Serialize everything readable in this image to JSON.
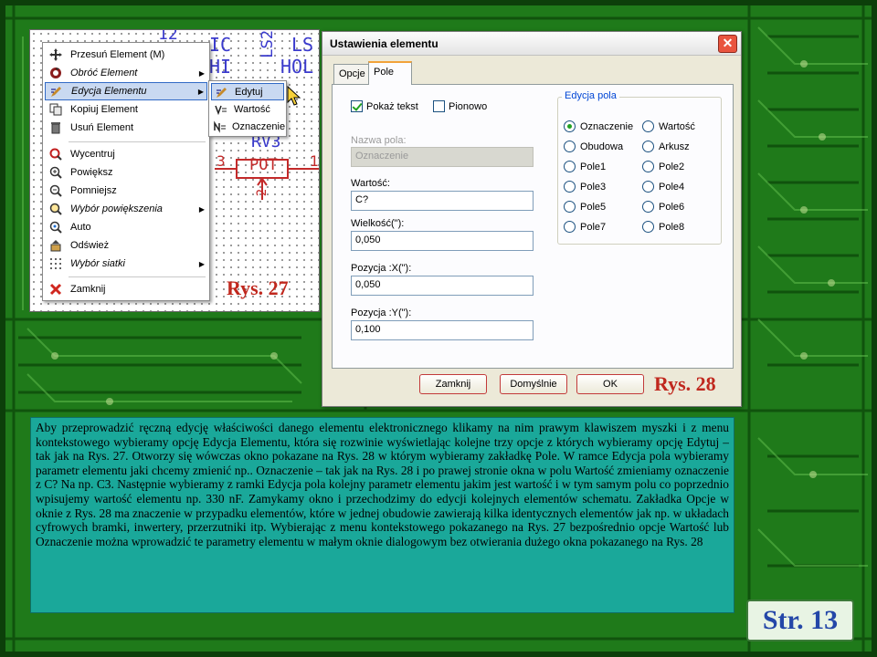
{
  "colors": {
    "pcb_green": "#1f7a1a",
    "label_red": "#c0281e",
    "text_box_teal": "#1aa89a",
    "page_number_blue": "#2447a8",
    "menu_highlight": "#c9d9f1"
  },
  "schematic": {
    "labels": {
      "top_ref": "12",
      "col1_a": "IC",
      "col1_b": "HI",
      "col2": "LS2",
      "col3_a": "LS",
      "col3_b": "HOL",
      "ref_rv": "RV3",
      "pin_left": "3",
      "pin_right": "1",
      "pin_bottom": "2",
      "part": "POT"
    }
  },
  "context_menu": {
    "items": [
      {
        "label": "Przesuń Element (M)",
        "icon": "move-icon",
        "submenu": false,
        "italic": false
      },
      {
        "label": "Obróć Element",
        "icon": "rotate-icon",
        "submenu": true,
        "italic": true
      },
      {
        "label": "Edycja Elementu",
        "icon": "edit-element-icon",
        "submenu": true,
        "italic": true,
        "highlighted": true
      },
      {
        "label": "Kopiuj Element",
        "icon": "copy-icon",
        "submenu": false,
        "italic": false
      },
      {
        "label": "Usuń Element",
        "icon": "delete-icon",
        "submenu": false,
        "italic": false
      },
      {
        "label": "Wycentruj",
        "icon": "center-icon",
        "submenu": false,
        "italic": false
      },
      {
        "label": "Powiększ",
        "icon": "zoom-in-icon",
        "submenu": false,
        "italic": false
      },
      {
        "label": "Pomniejsz",
        "icon": "zoom-out-icon",
        "submenu": false,
        "italic": false
      },
      {
        "label": "Wybór powiększenia",
        "icon": "zoom-select-icon",
        "submenu": true,
        "italic": true
      },
      {
        "label": "Auto",
        "icon": "auto-zoom-icon",
        "submenu": false,
        "italic": false
      },
      {
        "label": "Odśwież",
        "icon": "refresh-icon",
        "submenu": false,
        "italic": false
      },
      {
        "label": "Wybór siatki",
        "icon": "grid-icon",
        "submenu": true,
        "italic": true
      },
      {
        "label": "Zamknij",
        "icon": "close-x-icon",
        "submenu": false,
        "italic": false
      }
    ],
    "submenu": [
      {
        "label": "Edytuj",
        "icon": "edit-icon",
        "highlighted": true
      },
      {
        "label": "Wartość",
        "icon": "value-icon"
      },
      {
        "label": "Oznaczenie",
        "icon": "reference-icon"
      }
    ]
  },
  "rys27_label": "Rys. 27",
  "rys28_label": "Rys. 28",
  "dialog": {
    "title": "Ustawienia elementu",
    "close_glyph": "✕",
    "tabs": [
      "Opcje",
      "Pole"
    ],
    "checkboxes": [
      {
        "label": "Pokaż tekst",
        "checked": true
      },
      {
        "label": "Pionowo",
        "checked": false
      }
    ],
    "fields": [
      {
        "label": "Nazwa pola:",
        "value": "Oznaczenie",
        "disabled": true
      },
      {
        "label": "Wartość:",
        "value": "C?",
        "disabled": false
      },
      {
        "label": "Wielkość(\"):",
        "value": "0,050",
        "disabled": false
      },
      {
        "label": "Pozycja :X(\"):",
        "value": "0,050",
        "disabled": false
      },
      {
        "label": "Pozycja :Y(\"):",
        "value": "0,100",
        "disabled": false
      }
    ],
    "group_title": "Edycja pola",
    "radios_left": [
      {
        "label": "Oznaczenie",
        "checked": true
      },
      {
        "label": "Obudowa",
        "checked": false
      },
      {
        "label": "Pole1",
        "checked": false
      },
      {
        "label": "Pole3",
        "checked": false
      },
      {
        "label": "Pole5",
        "checked": false
      },
      {
        "label": "Pole7",
        "checked": false
      }
    ],
    "radios_right": [
      {
        "label": "Wartość",
        "checked": false
      },
      {
        "label": "Arkusz",
        "checked": false
      },
      {
        "label": "Pole2",
        "checked": false
      },
      {
        "label": "Pole4",
        "checked": false
      },
      {
        "label": "Pole6",
        "checked": false
      },
      {
        "label": "Pole8",
        "checked": false
      }
    ],
    "buttons": {
      "close": "Zamknij",
      "default": "Domyślnie",
      "ok": "OK"
    }
  },
  "description": "Aby przeprowadzić ręczną edycję właściwości danego elementu elektronicznego klikamy na nim prawym klawiszem myszki i z menu kontekstowego wybieramy opcję Edycja Elementu, która się rozwinie wyświetlając kolejne trzy opcje z których wybieramy opcję Edytuj – tak jak na Rys. 27. Otworzy się wówczas okno pokazane na Rys. 28 w którym wybieramy zakładkę Pole. W ramce Edycja pola wybieramy parametr elementu jaki chcemy zmienić np.. Oznaczenie – tak jak na Rys. 28 i po prawej stronie okna w polu Wartość zmieniamy oznaczenie z C? Na np. C3. Następnie wybieramy z ramki Edycja pola kolejny parametr elementu jakim jest wartość i w tym samym polu co poprzednio wpisujemy wartość elementu np. 330 nF. Zamykamy okno i przechodzimy do edycji kolejnych elementów schematu. Zakładka Opcje w oknie z Rys. 28 ma znaczenie w przypadku elementów, które w jednej obudowie zawierają kilka identycznych elementów jak np. w układach cyfrowych bramki, inwertery, przerzutniki itp. Wybierając z menu kontekstowego pokazanego na Rys. 27 bezpośrednio opcje Wartość lub Oznaczenie można wprowadzić te parametry elementu w małym oknie dialogowym bez otwierania dużego okna pokazanego na Rys. 28",
  "page_number": "Str. 13"
}
